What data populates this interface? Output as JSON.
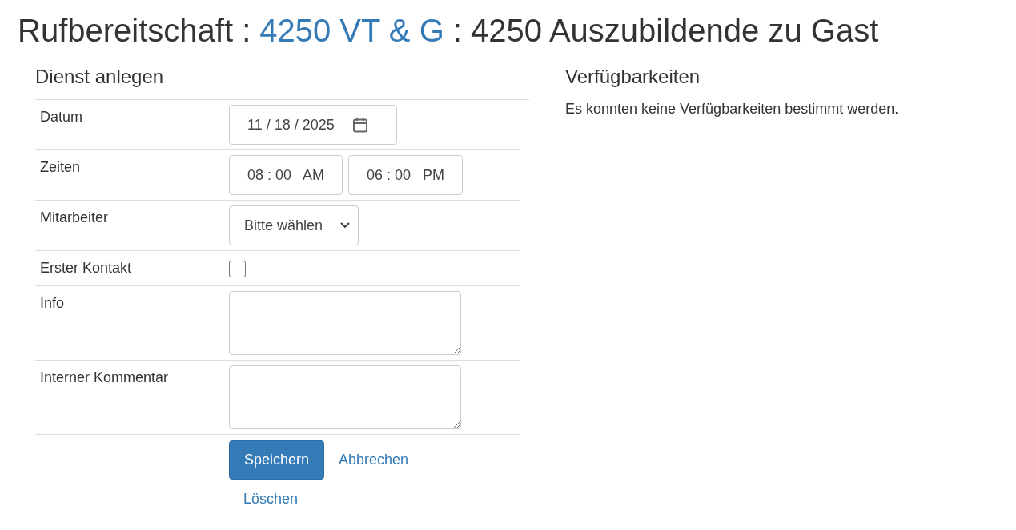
{
  "title": {
    "parts": [
      {
        "kind": "text",
        "text": "Rufbereitschaft :"
      },
      {
        "kind": "link",
        "text": "4250 VT & G"
      },
      {
        "kind": "text",
        "text": ": 4250 Auszubildende zu Gast"
      }
    ]
  },
  "form": {
    "heading": "Dienst anlegen",
    "rows": [
      {
        "label": "Datum",
        "kind": "date",
        "value": "11 / 18 / 2025"
      },
      {
        "label": "Zeiten",
        "kind": "time",
        "values": [
          "08 : 00   AM",
          "06 : 00   PM"
        ]
      },
      {
        "label": "Mitarbeiter",
        "kind": "select",
        "value": "Bitte wählen"
      },
      {
        "label": "Erster Kontakt",
        "kind": "checkbox",
        "checked": false
      },
      {
        "label": "Info",
        "kind": "textarea"
      },
      {
        "label": "Interner Kommentar",
        "kind": "textarea"
      }
    ],
    "save_button": "Speichern",
    "cancel_link": "Abbrechen",
    "delete_link": "Löschen"
  },
  "availability": {
    "heading": "Verfügbarkeiten",
    "message": "Es konnten keine Verfügbarkeiten bestimmt werden."
  }
}
